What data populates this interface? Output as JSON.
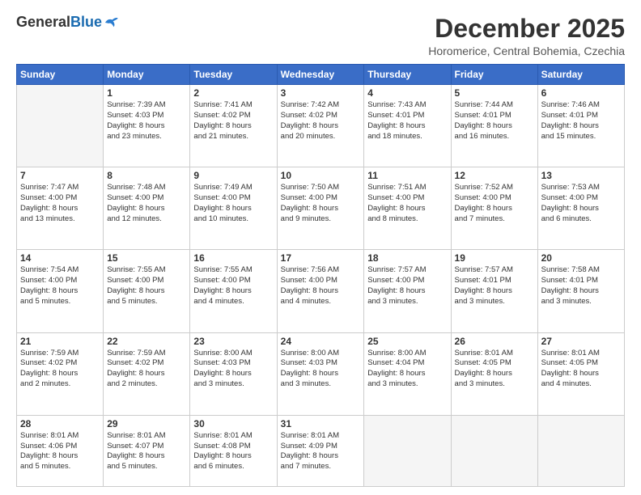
{
  "header": {
    "logo_general": "General",
    "logo_blue": "Blue",
    "month_title": "December 2025",
    "location": "Horomerice, Central Bohemia, Czechia"
  },
  "days_of_week": [
    "Sunday",
    "Monday",
    "Tuesday",
    "Wednesday",
    "Thursday",
    "Friday",
    "Saturday"
  ],
  "weeks": [
    [
      {
        "day": "",
        "info": ""
      },
      {
        "day": "1",
        "info": "Sunrise: 7:39 AM\nSunset: 4:03 PM\nDaylight: 8 hours\nand 23 minutes."
      },
      {
        "day": "2",
        "info": "Sunrise: 7:41 AM\nSunset: 4:02 PM\nDaylight: 8 hours\nand 21 minutes."
      },
      {
        "day": "3",
        "info": "Sunrise: 7:42 AM\nSunset: 4:02 PM\nDaylight: 8 hours\nand 20 minutes."
      },
      {
        "day": "4",
        "info": "Sunrise: 7:43 AM\nSunset: 4:01 PM\nDaylight: 8 hours\nand 18 minutes."
      },
      {
        "day": "5",
        "info": "Sunrise: 7:44 AM\nSunset: 4:01 PM\nDaylight: 8 hours\nand 16 minutes."
      },
      {
        "day": "6",
        "info": "Sunrise: 7:46 AM\nSunset: 4:01 PM\nDaylight: 8 hours\nand 15 minutes."
      }
    ],
    [
      {
        "day": "7",
        "info": "Sunrise: 7:47 AM\nSunset: 4:00 PM\nDaylight: 8 hours\nand 13 minutes."
      },
      {
        "day": "8",
        "info": "Sunrise: 7:48 AM\nSunset: 4:00 PM\nDaylight: 8 hours\nand 12 minutes."
      },
      {
        "day": "9",
        "info": "Sunrise: 7:49 AM\nSunset: 4:00 PM\nDaylight: 8 hours\nand 10 minutes."
      },
      {
        "day": "10",
        "info": "Sunrise: 7:50 AM\nSunset: 4:00 PM\nDaylight: 8 hours\nand 9 minutes."
      },
      {
        "day": "11",
        "info": "Sunrise: 7:51 AM\nSunset: 4:00 PM\nDaylight: 8 hours\nand 8 minutes."
      },
      {
        "day": "12",
        "info": "Sunrise: 7:52 AM\nSunset: 4:00 PM\nDaylight: 8 hours\nand 7 minutes."
      },
      {
        "day": "13",
        "info": "Sunrise: 7:53 AM\nSunset: 4:00 PM\nDaylight: 8 hours\nand 6 minutes."
      }
    ],
    [
      {
        "day": "14",
        "info": "Sunrise: 7:54 AM\nSunset: 4:00 PM\nDaylight: 8 hours\nand 5 minutes."
      },
      {
        "day": "15",
        "info": "Sunrise: 7:55 AM\nSunset: 4:00 PM\nDaylight: 8 hours\nand 5 minutes."
      },
      {
        "day": "16",
        "info": "Sunrise: 7:55 AM\nSunset: 4:00 PM\nDaylight: 8 hours\nand 4 minutes."
      },
      {
        "day": "17",
        "info": "Sunrise: 7:56 AM\nSunset: 4:00 PM\nDaylight: 8 hours\nand 4 minutes."
      },
      {
        "day": "18",
        "info": "Sunrise: 7:57 AM\nSunset: 4:00 PM\nDaylight: 8 hours\nand 3 minutes."
      },
      {
        "day": "19",
        "info": "Sunrise: 7:57 AM\nSunset: 4:01 PM\nDaylight: 8 hours\nand 3 minutes."
      },
      {
        "day": "20",
        "info": "Sunrise: 7:58 AM\nSunset: 4:01 PM\nDaylight: 8 hours\nand 3 minutes."
      }
    ],
    [
      {
        "day": "21",
        "info": "Sunrise: 7:59 AM\nSunset: 4:02 PM\nDaylight: 8 hours\nand 2 minutes."
      },
      {
        "day": "22",
        "info": "Sunrise: 7:59 AM\nSunset: 4:02 PM\nDaylight: 8 hours\nand 2 minutes."
      },
      {
        "day": "23",
        "info": "Sunrise: 8:00 AM\nSunset: 4:03 PM\nDaylight: 8 hours\nand 3 minutes."
      },
      {
        "day": "24",
        "info": "Sunrise: 8:00 AM\nSunset: 4:03 PM\nDaylight: 8 hours\nand 3 minutes."
      },
      {
        "day": "25",
        "info": "Sunrise: 8:00 AM\nSunset: 4:04 PM\nDaylight: 8 hours\nand 3 minutes."
      },
      {
        "day": "26",
        "info": "Sunrise: 8:01 AM\nSunset: 4:05 PM\nDaylight: 8 hours\nand 3 minutes."
      },
      {
        "day": "27",
        "info": "Sunrise: 8:01 AM\nSunset: 4:05 PM\nDaylight: 8 hours\nand 4 minutes."
      }
    ],
    [
      {
        "day": "28",
        "info": "Sunrise: 8:01 AM\nSunset: 4:06 PM\nDaylight: 8 hours\nand 5 minutes."
      },
      {
        "day": "29",
        "info": "Sunrise: 8:01 AM\nSunset: 4:07 PM\nDaylight: 8 hours\nand 5 minutes."
      },
      {
        "day": "30",
        "info": "Sunrise: 8:01 AM\nSunset: 4:08 PM\nDaylight: 8 hours\nand 6 minutes."
      },
      {
        "day": "31",
        "info": "Sunrise: 8:01 AM\nSunset: 4:09 PM\nDaylight: 8 hours\nand 7 minutes."
      },
      {
        "day": "",
        "info": ""
      },
      {
        "day": "",
        "info": ""
      },
      {
        "day": "",
        "info": ""
      }
    ]
  ]
}
